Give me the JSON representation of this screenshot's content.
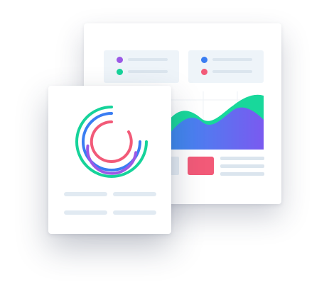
{
  "colors": {
    "purple": "#9b59e6",
    "green": "#16d39a",
    "blue": "#3a7df2",
    "pink": "#f25a78",
    "area_green": "#18d89b",
    "area_blue": "#3b8cf0",
    "area_purple": "#7a5af0",
    "line_gray": "#dbe5ee"
  },
  "icons": {
    "donut": "concentric-arc-chart-icon",
    "area_chart": "area-chart-icon"
  }
}
